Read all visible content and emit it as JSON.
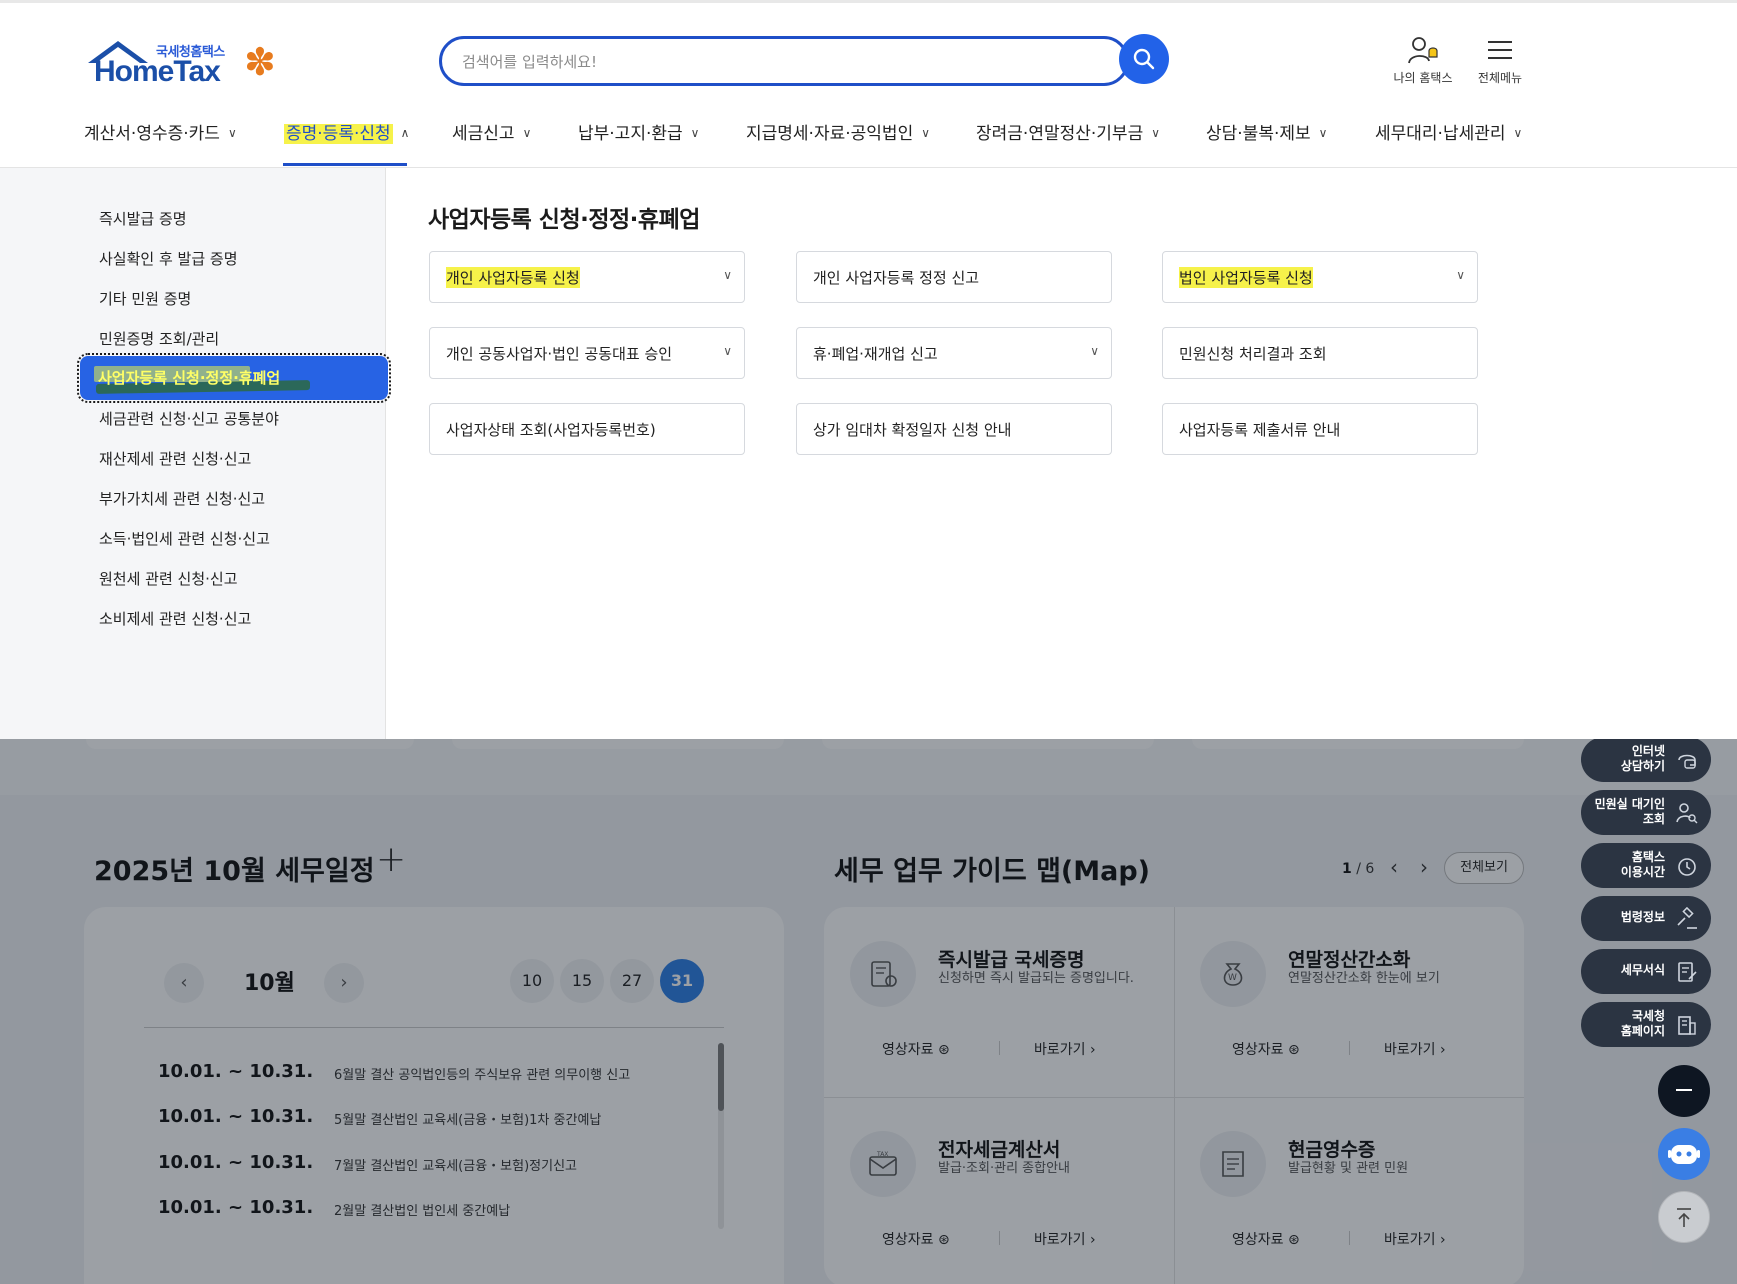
{
  "header": {
    "logo_small": "국세청홈택스",
    "logo_text": "HomeTax",
    "search_placeholder": "검색어를 입력하세요!",
    "my_hometax": "나의 홈택스",
    "all_menu": "전체메뉴"
  },
  "gnb": [
    {
      "label": "계산서·영수증·카드"
    },
    {
      "label": "증명·등록·신청"
    },
    {
      "label": "세금신고"
    },
    {
      "label": "납부·고지·환급"
    },
    {
      "label": "지급명세·자료·공익법인"
    },
    {
      "label": "장려금·연말정산·기부금"
    },
    {
      "label": "상담·불복·제보"
    },
    {
      "label": "세무대리·납세관리"
    }
  ],
  "side_menu": [
    {
      "label": "즉시발급 증명"
    },
    {
      "label": "사실확인 후 발급 증명"
    },
    {
      "label": "기타 민원 증명"
    },
    {
      "label": "민원증명 조회/관리"
    },
    {
      "label": "사업자등록 신청·정정·휴폐업"
    },
    {
      "label": "세금관련 신청·신고 공통분야"
    },
    {
      "label": "재산제세 관련 신청·신고"
    },
    {
      "label": "부가가치세 관련 신청·신고"
    },
    {
      "label": "소득·법인세 관련 신청·신고"
    },
    {
      "label": "원천세 관련 신청·신고"
    },
    {
      "label": "소비제세 관련 신청·신고"
    }
  ],
  "mega": {
    "title": "사업자등록 신청·정정·휴폐업",
    "cards": [
      {
        "label": "개인 사업자등록 신청"
      },
      {
        "label": "개인 사업자등록 정정 신고"
      },
      {
        "label": "법인 사업자등록 신청"
      },
      {
        "label": "개인 공동사업자·법인 공동대표 승인"
      },
      {
        "label": "휴·폐업·재개업 신고"
      },
      {
        "label": "민원신청 처리결과 조회"
      },
      {
        "label": "사업자상태 조회(사업자등록번호)"
      },
      {
        "label": "상가 임대차 확정일자 신청 안내"
      },
      {
        "label": "사업자등록 제출서류 안내"
      }
    ]
  },
  "schedule": {
    "title": "2025년 10월 세무일정",
    "plus": "+",
    "month": "10월",
    "days": [
      "10",
      "15",
      "27",
      "31"
    ],
    "rows": [
      {
        "date": "10.01. ~ 10.31.",
        "text": "6월말 결산 공익법인등의 주식보유 관련 의무이행 신고"
      },
      {
        "date": "10.01. ~ 10.31.",
        "text": "5월말 결산법인 교육세(금융・보험)1차 중간예납"
      },
      {
        "date": "10.01. ~ 10.31.",
        "text": "7월말 결산법인 교육세(금융・보험)정기신고"
      },
      {
        "date": "10.01. ~ 10.31.",
        "text": "2월말 결산법인 법인세 중간예납"
      }
    ]
  },
  "guide": {
    "title": "세무 업무 가이드 맵(Map)",
    "page_current": "1",
    "page_total": "/ 6",
    "all_label": "전체보기",
    "video_label": "영상자료",
    "go_label": "바로가기",
    "cards": [
      {
        "title": "즉시발급 국세증명",
        "desc": "신청하면 즉시 발급되는 증명입니다."
      },
      {
        "title": "연말정산간소화",
        "desc": "연말정산간소화 한눈에 보기"
      },
      {
        "title": "전자세금계산서",
        "desc": "발급·조회·관리 종합안내"
      },
      {
        "title": "현금영수증",
        "desc": "발급현황 및 관련 민원"
      }
    ]
  },
  "quick_menu": [
    {
      "label": "인터넷\n상담하기"
    },
    {
      "label": "민원실 대기인\n조회"
    },
    {
      "label": "홈택스\n이용시간"
    },
    {
      "label": "법령정보"
    },
    {
      "label": "세무서식"
    },
    {
      "label": "국세청\n홈페이지"
    }
  ],
  "colors": {
    "brand": "#1f4fc8",
    "highlight": "#f6f24a",
    "accent_blue": "#2262e8"
  }
}
